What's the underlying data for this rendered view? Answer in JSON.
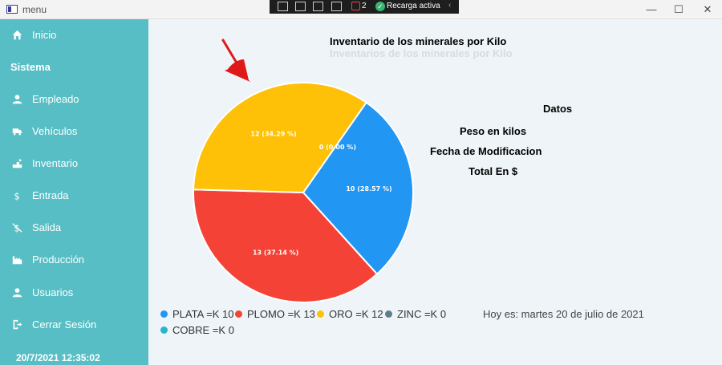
{
  "window": {
    "title": "menu"
  },
  "debug_toolbar": {
    "badge_count": "2",
    "reload_label": "Recarga activa"
  },
  "sidebar": {
    "items": [
      {
        "label": "Inicio",
        "icon": "home-icon"
      },
      {
        "label": "Empleado",
        "icon": "person-icon"
      },
      {
        "label": "Vehículos",
        "icon": "truck-icon"
      },
      {
        "label": "Inventario",
        "icon": "inventory-icon"
      },
      {
        "label": "Entrada",
        "icon": "dollar-icon"
      },
      {
        "label": "Salida",
        "icon": "no-dollar-icon"
      },
      {
        "label": "Producción",
        "icon": "factory-icon"
      },
      {
        "label": "Usuarios",
        "icon": "person-icon"
      },
      {
        "label": "Cerrar Sesión",
        "icon": "logout-icon"
      }
    ],
    "section_title": "Sistema",
    "datetime": "20/7/2021 12:35:02"
  },
  "chart_data": {
    "type": "pie",
    "title": "Inventario de los minerales por Kilo",
    "subtitle": "Inventarios de los minerales por Kilo",
    "slices": [
      {
        "name": "PLATA",
        "value": 10,
        "label": "10 (28.57 %)",
        "legend": "PLATA =K 10",
        "color": "#2196f3"
      },
      {
        "name": "PLOMO",
        "value": 13,
        "label": "13 (37.14 %)",
        "legend": "PLOMO =K 13",
        "color": "#f44336"
      },
      {
        "name": "ORO",
        "value": 12,
        "label": "12 (34.29 %)",
        "legend": "ORO =K 12",
        "color": "#ffc107"
      },
      {
        "name": "ZINC",
        "value": 0,
        "label": "0 (0.00 %)",
        "legend": "ZINC =K 0",
        "color": "#607d8b"
      },
      {
        "name": "COBRE",
        "value": 0,
        "label": "",
        "legend": "COBRE =K 0",
        "color": "#26b6d0"
      }
    ]
  },
  "details": {
    "title": "Datos",
    "weight_label": "Peso en kilos",
    "modified_label": "Fecha de Modificacion",
    "total_label": "Total En $"
  },
  "footer": {
    "today": "Hoy es: martes 20 de julio de 2021"
  }
}
